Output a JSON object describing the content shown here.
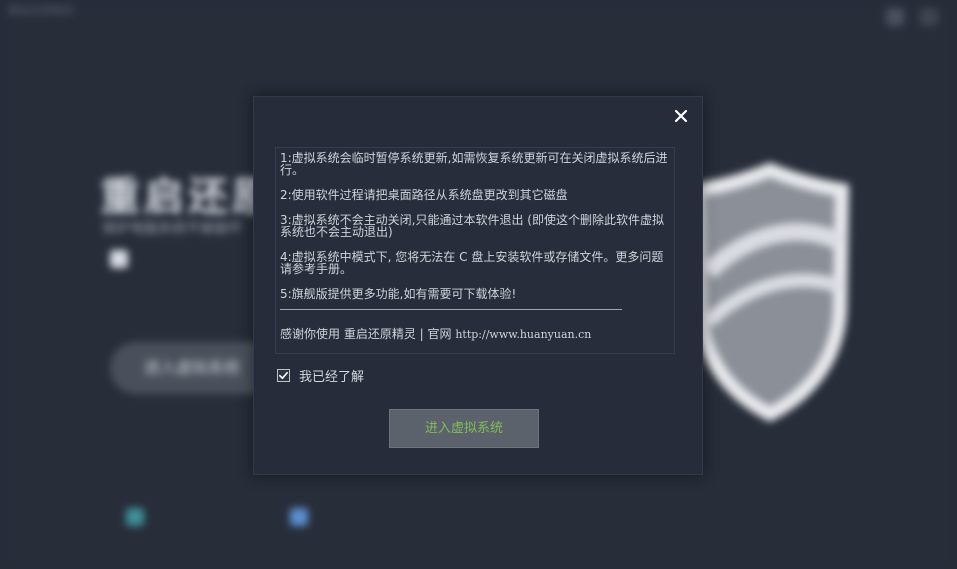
{
  "background": {
    "app_name": "重启还原精灵",
    "title": "重启还原",
    "subtitle": "保护电脑系统不被破坏",
    "option_label": "",
    "main_button": "进入虚拟系统",
    "links": [
      "",
      ""
    ]
  },
  "dialog": {
    "notices": [
      "1:虚拟系统会临时暂停系统更新,如需恢复系统更新可在关闭虚拟系统后进行。",
      "2:使用软件过程请把桌面路径从系统盘更改到其它磁盘",
      "3:虚拟系统不会主动关闭,只能通过本软件退出 (即使这个删除此软件虚拟系统也不会主动退出)",
      "4:虚拟系统中模式下, 您将无法在 C 盘上安装软件或存储文件。更多问题请参考手册。",
      "5:旗舰版提供更多功能,如有需要可下载体验!"
    ],
    "thanks": "感谢你使用 重启还原精灵 | 官网",
    "url": "http://www.huanyuan.cn",
    "agree_label": "我已经了解",
    "agree_checked": true,
    "enter_button": "进入虚拟系统"
  },
  "colors": {
    "dialog_bg": "#262c39",
    "button_text": "#82bc5a",
    "button_bg": "#5c626c"
  }
}
